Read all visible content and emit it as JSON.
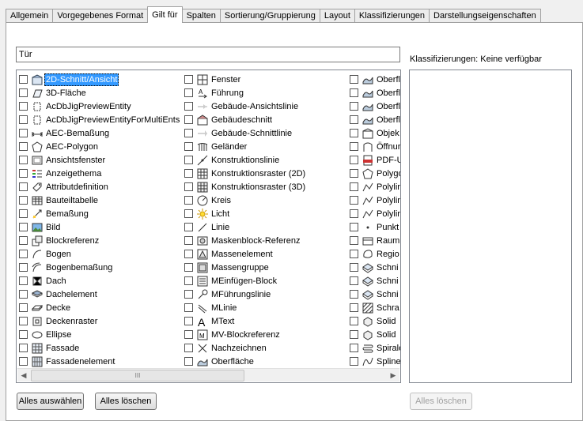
{
  "tabs": [
    "Allgemein",
    "Vorgegebenes Format",
    "Gilt für",
    "Spalten",
    "Sortierung/Gruppierung",
    "Layout",
    "Klassifizierungen",
    "Darstellungseigenschaften"
  ],
  "active_tab": "Gilt für",
  "search": {
    "value": "Tür"
  },
  "list": {
    "col1": [
      {
        "label": "2D-Schnitt/Ansicht",
        "icon": "2d-section-icon",
        "selected": true
      },
      {
        "label": "3D-Fläche",
        "icon": "3d-face-icon"
      },
      {
        "label": "AcDbJigPreviewEntity",
        "icon": "entity-icon"
      },
      {
        "label": "AcDbJigPreviewEntityForMultiEnts",
        "icon": "entity-icon"
      },
      {
        "label": "AEC-Bemaßung",
        "icon": "aec-dimension-icon"
      },
      {
        "label": "AEC-Polygon",
        "icon": "polygon-icon"
      },
      {
        "label": "Ansichtsfenster",
        "icon": "viewport-icon"
      },
      {
        "label": "Anzeigethema",
        "icon": "display-theme-icon"
      },
      {
        "label": "Attributdefinition",
        "icon": "attribute-icon"
      },
      {
        "label": "Bauteiltabelle",
        "icon": "table-icon"
      },
      {
        "label": "Bemaßung",
        "icon": "dimension-icon"
      },
      {
        "label": "Bild",
        "icon": "image-icon"
      },
      {
        "label": "Blockreferenz",
        "icon": "block-icon"
      },
      {
        "label": "Bogen",
        "icon": "arc-icon"
      },
      {
        "label": "Bogenbemaßung",
        "icon": "arc-dimension-icon"
      },
      {
        "label": "Dach",
        "icon": "roof-icon"
      },
      {
        "label": "Dachelement",
        "icon": "roof-slab-icon"
      },
      {
        "label": "Decke",
        "icon": "slab-icon"
      },
      {
        "label": "Deckenraster",
        "icon": "ceiling-grid-icon"
      },
      {
        "label": "Ellipse",
        "icon": "ellipse-icon"
      },
      {
        "label": "Fassade",
        "icon": "curtain-wall-icon"
      },
      {
        "label": "Fassadenelement",
        "icon": "curtain-wall-unit-icon"
      }
    ],
    "col2": [
      {
        "label": "Fenster",
        "icon": "window-icon"
      },
      {
        "label": "Führung",
        "icon": "leader-icon"
      },
      {
        "label": "Gebäude-Ansichtslinie",
        "icon": "elevation-line-icon"
      },
      {
        "label": "Gebäudeschnitt",
        "icon": "building-section-icon"
      },
      {
        "label": "Gebäude-Schnittlinie",
        "icon": "section-line-icon"
      },
      {
        "label": "Geländer",
        "icon": "railing-icon"
      },
      {
        "label": "Konstruktionslinie",
        "icon": "xline-icon"
      },
      {
        "label": "Konstruktionsraster (2D)",
        "icon": "grid-2d-icon"
      },
      {
        "label": "Konstruktionsraster (3D)",
        "icon": "grid-3d-icon"
      },
      {
        "label": "Kreis",
        "icon": "circle-icon"
      },
      {
        "label": "Licht",
        "icon": "light-icon"
      },
      {
        "label": "Linie",
        "icon": "line-icon"
      },
      {
        "label": "Maskenblock-Referenz",
        "icon": "mask-block-icon"
      },
      {
        "label": "Massenelement",
        "icon": "mass-element-icon"
      },
      {
        "label": "Massengruppe",
        "icon": "mass-group-icon"
      },
      {
        "label": "MEinfügen-Block",
        "icon": "minsert-block-icon"
      },
      {
        "label": "MFührungslinie",
        "icon": "mleader-icon"
      },
      {
        "label": "MLinie",
        "icon": "mline-icon"
      },
      {
        "label": "MText",
        "icon": "mtext-icon"
      },
      {
        "label": "MV-Blockreferenz",
        "icon": "mv-block-icon"
      },
      {
        "label": "Nachzeichnen",
        "icon": "trace-icon"
      },
      {
        "label": "Oberfläche",
        "icon": "surface-icon"
      }
    ],
    "col3": [
      {
        "label": "Oberfl",
        "icon": "surface-icon"
      },
      {
        "label": "Oberfl",
        "icon": "surface-icon"
      },
      {
        "label": "Oberfl",
        "icon": "surface-icon"
      },
      {
        "label": "Oberfl",
        "icon": "surface-icon"
      },
      {
        "label": "Objek",
        "icon": "object-icon"
      },
      {
        "label": "Öffnur",
        "icon": "opening-icon"
      },
      {
        "label": "PDF-U",
        "icon": "pdf-icon"
      },
      {
        "label": "Polygo",
        "icon": "polygon-icon"
      },
      {
        "label": "Polylir",
        "icon": "polyline-icon"
      },
      {
        "label": "Polylir",
        "icon": "polyline-icon"
      },
      {
        "label": "Polylir",
        "icon": "polyline-icon"
      },
      {
        "label": "Punkt",
        "icon": "point-icon"
      },
      {
        "label": "Raum",
        "icon": "space-icon"
      },
      {
        "label": "Regio",
        "icon": "region-icon"
      },
      {
        "label": "Schni",
        "icon": "section-icon"
      },
      {
        "label": "Schni",
        "icon": "section-icon"
      },
      {
        "label": "Schni",
        "icon": "section-icon"
      },
      {
        "label": "Schra",
        "icon": "hatch-icon"
      },
      {
        "label": "Solid",
        "icon": "solid-icon"
      },
      {
        "label": "Solid",
        "icon": "solid-icon"
      },
      {
        "label": "Spirale",
        "icon": "helix-icon"
      },
      {
        "label": "Spline",
        "icon": "spline-icon"
      }
    ]
  },
  "scrollbar": {
    "thumb_grip": "III"
  },
  "buttons": {
    "select_all": "Alles auswählen",
    "clear_all": "Alles löschen",
    "clear_classifications": "Alles löschen"
  },
  "classifications": {
    "label": "Klassifizierungen: Keine verfügbar"
  }
}
